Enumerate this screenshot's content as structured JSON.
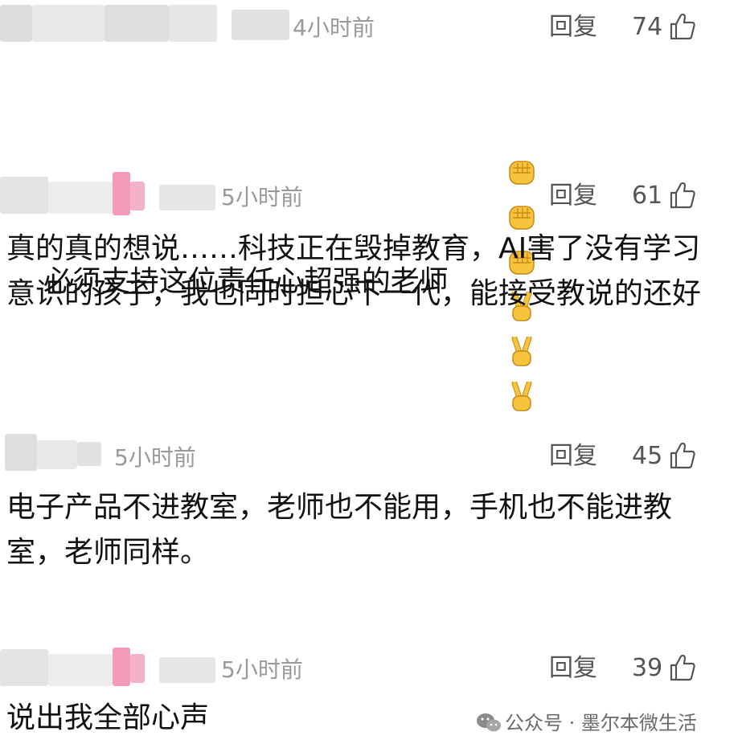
{
  "comments": [
    {
      "time": "4小时前",
      "reply_label": "回复",
      "likes": "74",
      "text": "必须支持这位责任心超强的老师",
      "emojis": [
        "fist-emoji",
        "fist-emoji",
        "fist-emoji",
        "victory-hand-emoji",
        "victory-hand-emoji",
        "victory-hand-emoji"
      ]
    },
    {
      "time": "5小时前",
      "reply_label": "回复",
      "likes": "61",
      "text": "真的真的想说……科技正在毁掉教育，AI害了没有学习意识的孩子，我也同时担心下一代，能接受教说的还好"
    },
    {
      "time": "5小时前",
      "reply_label": "回复",
      "likes": "45",
      "text": "电子产品不进教室，老师也不能用，手机也不能进教室，老师同样。"
    },
    {
      "time": "5小时前",
      "reply_label": "回复",
      "likes": "39",
      "text": "说出我全部心声"
    }
  ],
  "watermark": {
    "text": "公众号 · 墨尔本微生活",
    "icon": "wechat-icon"
  },
  "colors": {
    "time_gray": "#9a9a9a",
    "action_gray": "#555555",
    "emoji_yellow": "#f6c33c",
    "blur_pink": "#f07aa6"
  }
}
